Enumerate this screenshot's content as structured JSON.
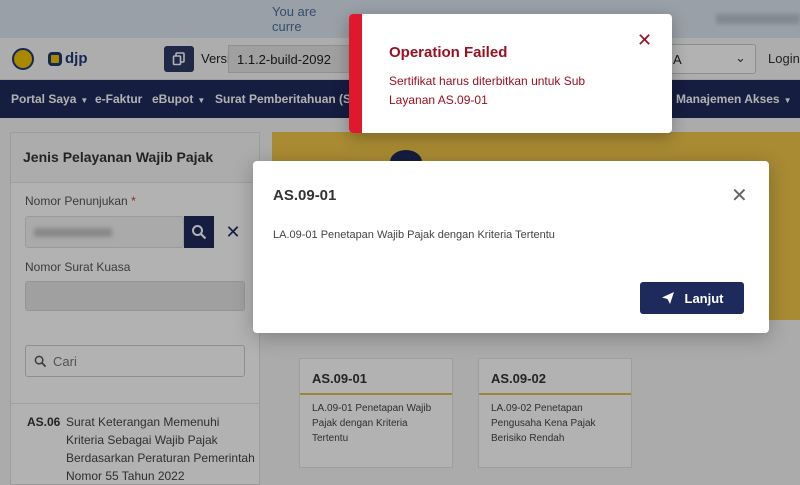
{
  "banner": {
    "text": "You are curre"
  },
  "topbar": {
    "version_label": "Versi:",
    "version_value": "1.1.2-build-2092",
    "select_value": "A",
    "login_label": "Login"
  },
  "logo": {
    "text": "djp"
  },
  "nav": {
    "items": [
      {
        "label": "Portal Saya"
      },
      {
        "label": "e-Faktur"
      },
      {
        "label": "eBupot"
      },
      {
        "label": "Surat Pemberitahuan (SPT"
      },
      {
        "label": "Manajemen Akses"
      }
    ]
  },
  "left": {
    "title": "Jenis Pelayanan Wajib Pajak",
    "nomor_penunjukan_label": "Nomor Penunjukan",
    "required_mark": "*",
    "nomor_surat_kuasa_label": "Nomor Surat Kuasa",
    "search_placeholder": "Cari",
    "list": [
      {
        "code": "AS.06",
        "text": "Surat Keterangan Memenuhi Kriteria Sebagai Wajib Pajak Berdasarkan Peraturan Pemerintah Nomor 55 Tahun 2022"
      }
    ]
  },
  "right": {
    "banner_text": "N",
    "cards": [
      {
        "code": "AS.09-01",
        "desc": "LA.09-01 Penetapan Wajib Pajak dengan Kriteria Tertentu"
      },
      {
        "code": "AS.09-02",
        "desc": "LA.09-02 Penetapan Pengusaha Kena Pajak Berisiko Rendah"
      }
    ]
  },
  "modal": {
    "title": "AS.09-01",
    "description": "LA.09-01 Penetapan Wajib Pajak dengan Kriteria Tertentu",
    "button_label": "Lanjut"
  },
  "toast": {
    "title": "Operation Failed",
    "message": "Sertifikat harus diterbitkan untuk Sub Layanan AS.09-01",
    "accent_color": "#e0182d"
  }
}
